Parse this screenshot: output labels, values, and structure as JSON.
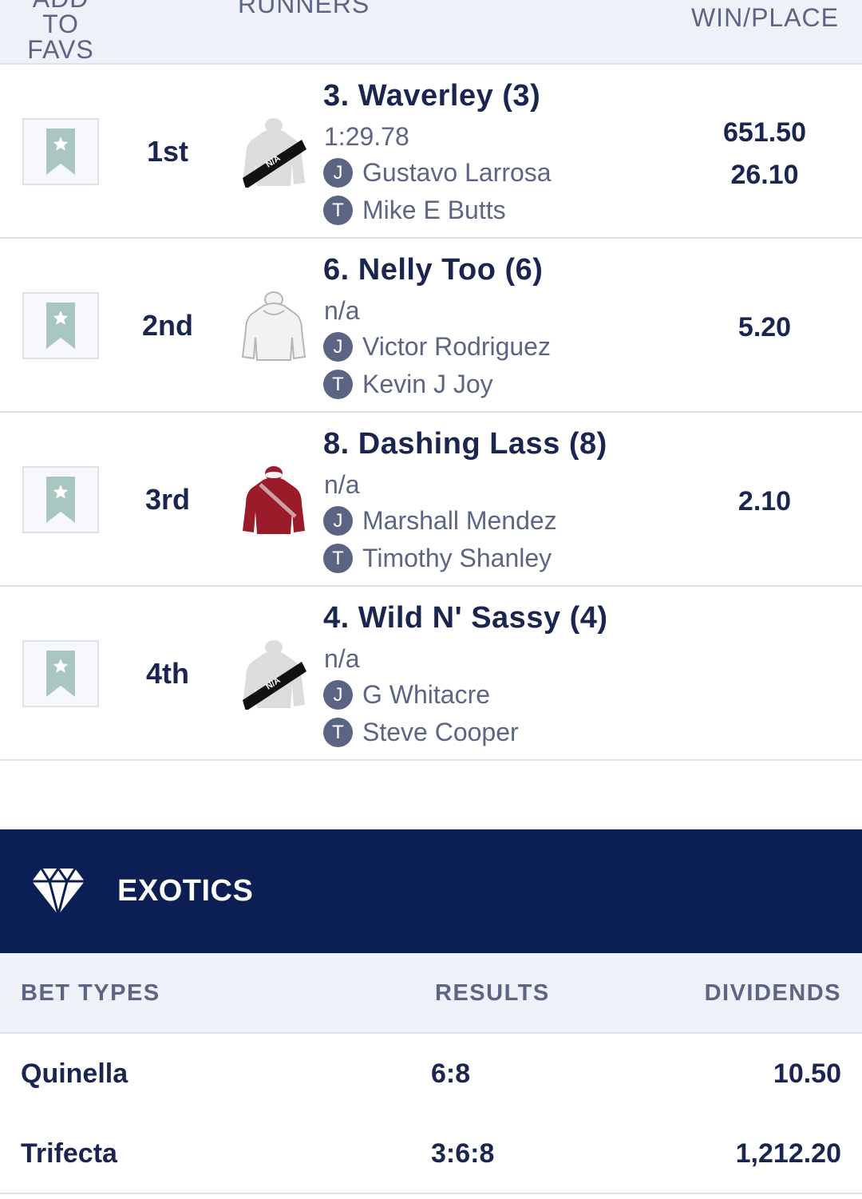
{
  "header": {
    "favs_line1": "ADD",
    "favs_line2": "TO",
    "favs_line3": "FAVS",
    "runners": "RUNNERS",
    "win_place": "WIN/PLACE"
  },
  "runners": [
    {
      "position": "1st",
      "name": "3.  Waverley  (3)",
      "time": "1:29.78",
      "jockey_badge": "J",
      "jockey": "Gustavo Larrosa",
      "trainer_badge": "T",
      "trainer": "Mike E Butts",
      "win": "651.50",
      "place": "26.10",
      "silk": "na-silk-icon"
    },
    {
      "position": "2nd",
      "name": "6.  Nelly Too  (6)",
      "time": "n/a",
      "jockey_badge": "J",
      "jockey": "Victor Rodriguez",
      "trainer_badge": "T",
      "trainer": "Kevin J Joy",
      "place": "5.20",
      "silk": "white-silk-icon"
    },
    {
      "position": "3rd",
      "name": "8.  Dashing Lass  (8)",
      "time": "n/a",
      "jockey_badge": "J",
      "jockey": "Marshall Mendez",
      "trainer_badge": "T",
      "trainer": "Timothy Shanley",
      "place": "2.10",
      "silk": "maroon-silk-icon"
    },
    {
      "position": "4th",
      "name": "4.  Wild N' Sassy  (4)",
      "time": "n/a",
      "jockey_badge": "J",
      "jockey": "G Whitacre",
      "trainer_badge": "T",
      "trainer": "Steve Cooper",
      "silk": "na-silk-icon"
    }
  ],
  "exotics": {
    "title": "EXOTICS",
    "columns": {
      "bet_types": "BET TYPES",
      "results": "RESULTS",
      "dividends": "DIVIDENDS"
    },
    "rows": [
      {
        "type": "Quinella",
        "result": "6:8",
        "dividend": "10.50"
      },
      {
        "type": "Trifecta",
        "result": "3:6:8",
        "dividend": "1,212.20"
      }
    ]
  },
  "silk_label": "N/A",
  "colors": {
    "navy": "#0b1f55",
    "text_dark": "#1a2550",
    "text_muted": "#5d6585",
    "header_bg": "#eef1f8",
    "badge": "#5b6483",
    "maroon_silk": "#9a1c2b"
  }
}
